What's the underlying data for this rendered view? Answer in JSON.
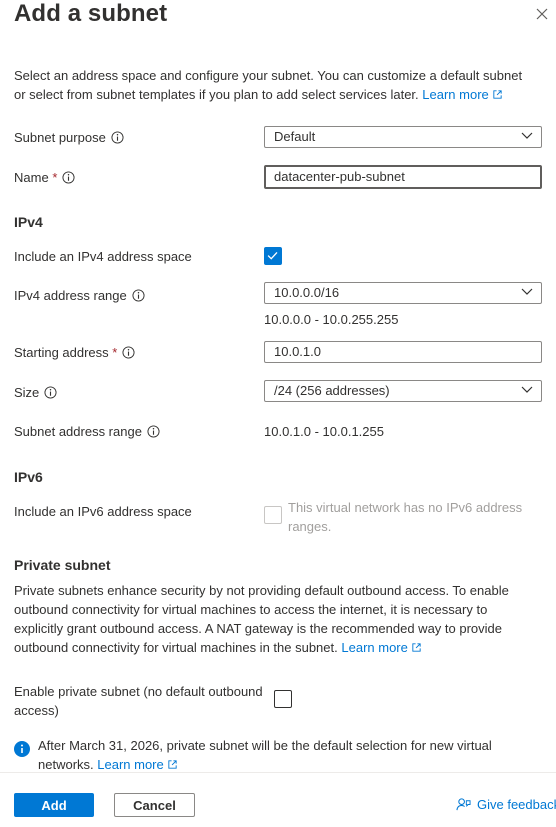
{
  "panel": {
    "title": "Add a subnet",
    "intro": "Select an address space and configure your subnet. You can customize a default subnet or select from subnet templates if you plan to add select services later.",
    "learn_more": "Learn more"
  },
  "form": {
    "subnet_purpose_label": "Subnet purpose",
    "subnet_purpose_value": "Default",
    "name_label": "Name",
    "name_required": "*",
    "name_value": "datacenter-pub-subnet",
    "ipv4_section": "IPv4",
    "include_ipv4_label": "Include an IPv4 address space",
    "include_ipv4_checked": true,
    "ipv4_range_label": "IPv4 address range",
    "ipv4_range_value": "10.0.0.0/16",
    "ipv4_range_hint": "10.0.0.0 - 10.0.255.255",
    "starting_address_label": "Starting address",
    "starting_address_required": "*",
    "starting_address_value": "10.0.1.0",
    "size_label": "Size",
    "size_value": "/24 (256 addresses)",
    "subnet_range_label": "Subnet address range",
    "subnet_range_value": "10.0.1.0 - 10.0.1.255",
    "ipv6_section": "IPv6",
    "include_ipv6_label": "Include an IPv6 address space",
    "ipv6_disabled_text": "This virtual network has no IPv6 address ranges.",
    "private_section": "Private subnet",
    "private_desc": "Private subnets enhance security by not providing default outbound access. To enable outbound connectivity for virtual machines to access the internet, it is necessary to explicitly grant outbound access. A NAT gateway is the recommended way to provide outbound connectivity for virtual machines in the subnet.",
    "private_learn_more": "Learn more",
    "enable_private_label": "Enable private subnet (no default outbound access)",
    "notice_text": "After March 31, 2026, private subnet will be the default selection for new virtual networks.",
    "notice_learn_more": "Learn more"
  },
  "footer": {
    "add_label": "Add",
    "cancel_label": "Cancel",
    "feedback_label": "Give feedback"
  },
  "colors": {
    "accent": "#0078d4",
    "text": "#323130",
    "required": "#a4262c",
    "disabled": "#a19f9d"
  }
}
